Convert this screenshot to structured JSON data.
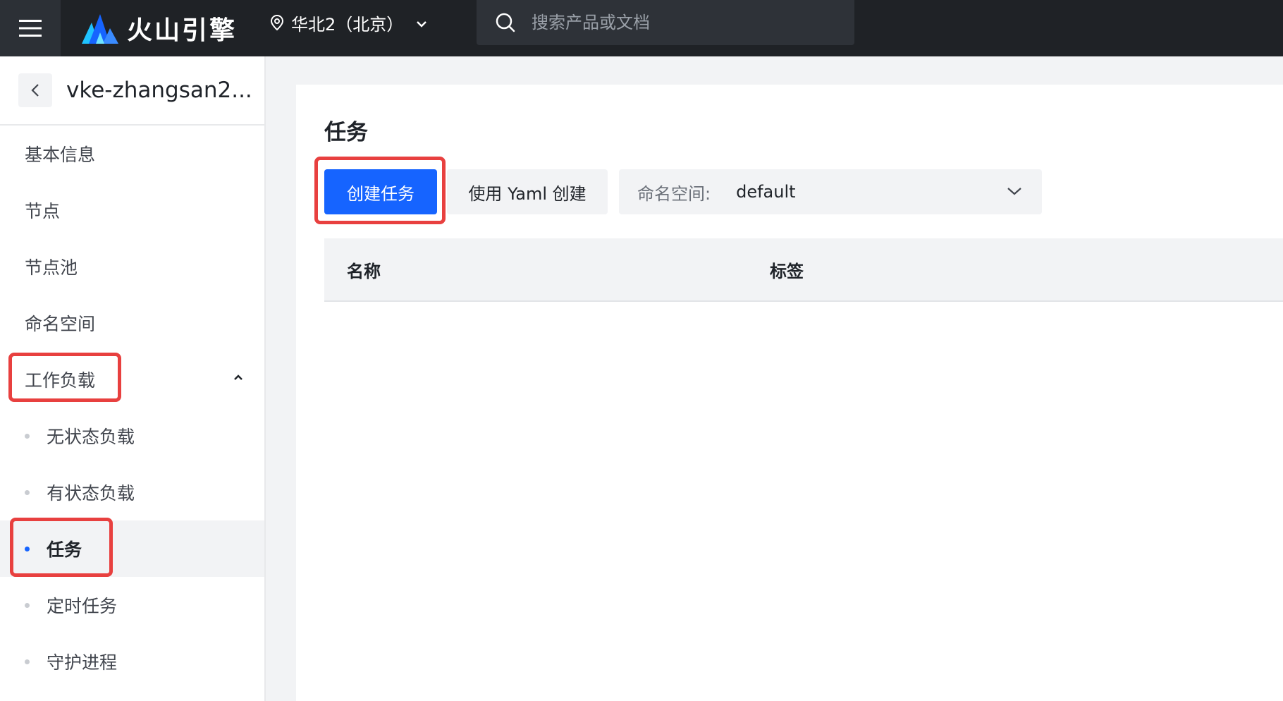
{
  "topbar": {
    "brand": "火山引擎",
    "region": "华北2（北京）",
    "search_placeholder": "搜索产品或文档"
  },
  "sidebar": {
    "cluster_name": "vke-zhangsan2...",
    "items": [
      {
        "label": "基本信息"
      },
      {
        "label": "节点"
      },
      {
        "label": "节点池"
      },
      {
        "label": "命名空间"
      },
      {
        "label": "工作负载",
        "expanded": true
      },
      {
        "label": "无状态负载"
      },
      {
        "label": "有状态负载"
      },
      {
        "label": "任务",
        "active": true
      },
      {
        "label": "定时任务"
      },
      {
        "label": "守护进程"
      }
    ]
  },
  "main": {
    "title": "任务",
    "create_button": "创建任务",
    "yaml_button": "使用 Yaml 创建",
    "namespace": {
      "label": "命名空间:",
      "value": "default"
    },
    "table": {
      "columns": [
        "名称",
        "标签"
      ]
    }
  },
  "colors": {
    "accent": "#1664ff",
    "topbar": "#1f2226",
    "highlight": "#e8403f"
  }
}
